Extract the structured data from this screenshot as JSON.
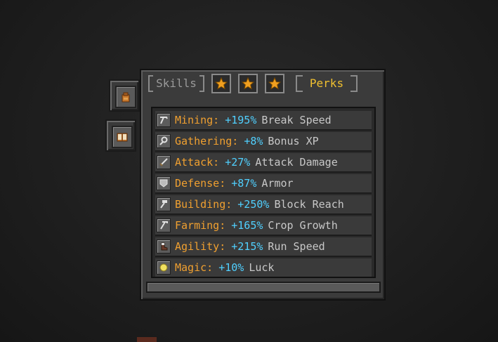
{
  "tabs": {
    "skills_label": "Skills",
    "perks_label": "Perks",
    "star_tabs": [
      "star-icon",
      "star-icon",
      "star-icon"
    ],
    "active": "Perks"
  },
  "side_tabs": [
    "backpack-icon",
    "book-icon"
  ],
  "perks": [
    {
      "icon": "pickaxe-icon",
      "name": "Mining:",
      "bonus": "+195%",
      "desc": "Break Speed"
    },
    {
      "icon": "gather-icon",
      "name": "Gathering:",
      "bonus": "+8%",
      "desc": "Bonus XP"
    },
    {
      "icon": "sword-icon",
      "name": "Attack:",
      "bonus": "+27%",
      "desc": "Attack Damage"
    },
    {
      "icon": "shield-icon",
      "name": "Defense:",
      "bonus": "+87%",
      "desc": "Armor"
    },
    {
      "icon": "hammer-icon",
      "name": "Building:",
      "bonus": "+250%",
      "desc": "Block Reach"
    },
    {
      "icon": "hoe-icon",
      "name": "Farming:",
      "bonus": "+165%",
      "desc": "Crop Growth"
    },
    {
      "icon": "boot-icon",
      "name": "Agility:",
      "bonus": "+215%",
      "desc": "Run Speed"
    },
    {
      "icon": "orb-icon",
      "name": "Magic:",
      "bonus": "+10%",
      "desc": "Luck"
    }
  ],
  "colors": {
    "name": "#f0a030",
    "bonus": "#50d0ff",
    "desc": "#c8c8c8",
    "active_tab": "#f0c030",
    "inactive_tab": "#9a9a9a",
    "star": "#f0a020"
  }
}
